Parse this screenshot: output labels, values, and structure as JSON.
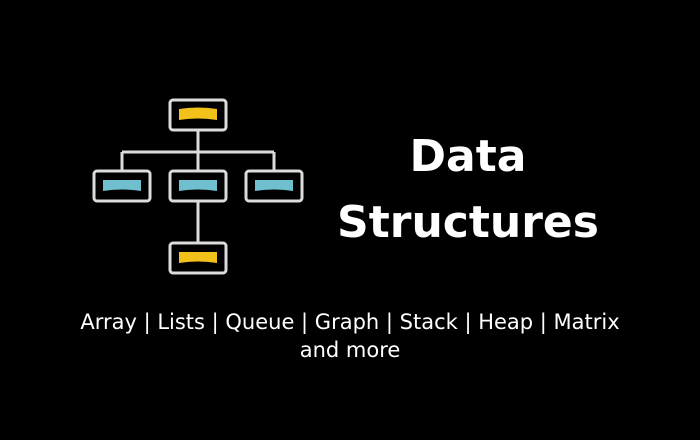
{
  "title": {
    "line1": "Data",
    "line2": "Structures"
  },
  "subtitle": {
    "line1": "Array | Lists | Queue | Graph | Stack | Heap | Matrix",
    "line2": "and more"
  },
  "colors": {
    "background": "#000000",
    "text": "#ffffff",
    "node_border": "#dcdcdc",
    "node_fill": "#000000",
    "accent_yellow": "#f2c21b",
    "accent_blue": "#6fbfcf",
    "connector": "#dcdcdc"
  },
  "diagram": {
    "icon": "tree-diagram-icon"
  }
}
